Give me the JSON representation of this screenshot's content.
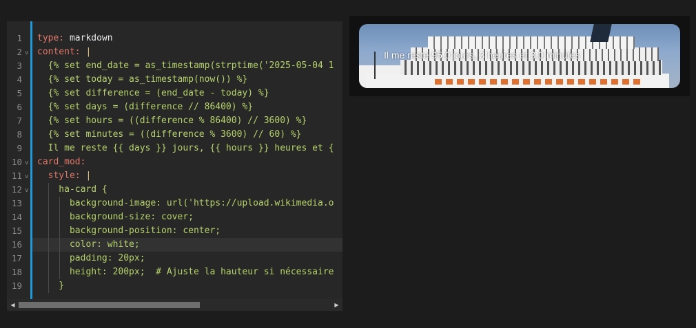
{
  "editor": {
    "lines": [
      {
        "n": "1",
        "parts": [
          {
            "c": "k",
            "t": "type:"
          },
          {
            "c": "t",
            "t": " markdown"
          }
        ]
      },
      {
        "n": "2",
        "fold": true,
        "parts": [
          {
            "c": "k",
            "t": "content:"
          },
          {
            "c": "t",
            "t": " "
          },
          {
            "c": "p",
            "t": "|"
          }
        ]
      },
      {
        "n": "3",
        "parts": [
          {
            "c": "j",
            "t": "  {% set end_date = as_timestamp(strptime('2025-05-04 1"
          }
        ]
      },
      {
        "n": "4",
        "parts": [
          {
            "c": "j",
            "t": "  {% set today = as_timestamp(now()) %}"
          }
        ]
      },
      {
        "n": "5",
        "parts": [
          {
            "c": "j",
            "t": "  {% set difference = (end_date - today) %}"
          }
        ]
      },
      {
        "n": "6",
        "parts": [
          {
            "c": "j",
            "t": "  {% set days = (difference // 86400) %}"
          }
        ]
      },
      {
        "n": "7",
        "parts": [
          {
            "c": "j",
            "t": "  {% set hours = ((difference % 86400) // 3600) %}"
          }
        ]
      },
      {
        "n": "8",
        "parts": [
          {
            "c": "j",
            "t": "  {% set minutes = ((difference % 3600) // 60) %}"
          }
        ]
      },
      {
        "n": "9",
        "parts": [
          {
            "c": "j",
            "t": "  Il me reste {{ days }} jours, {{ hours }} heures et {"
          }
        ]
      },
      {
        "n": "10",
        "fold": true,
        "parts": [
          {
            "c": "k",
            "t": "card_mod:"
          }
        ]
      },
      {
        "n": "11",
        "fold": true,
        "parts": [
          {
            "c": "t",
            "t": "  "
          },
          {
            "c": "k",
            "t": "style:"
          },
          {
            "c": "t",
            "t": " "
          },
          {
            "c": "p",
            "t": "|"
          }
        ]
      },
      {
        "n": "12",
        "fold": true,
        "parts": [
          {
            "c": "j",
            "t": "    ha-card {"
          }
        ]
      },
      {
        "n": "13",
        "parts": [
          {
            "c": "j",
            "t": "      background-image: url('https://upload.wikimedia.o"
          }
        ]
      },
      {
        "n": "14",
        "parts": [
          {
            "c": "j",
            "t": "      background-size: cover;"
          }
        ]
      },
      {
        "n": "15",
        "parts": [
          {
            "c": "j",
            "t": "      background-position: center;"
          }
        ]
      },
      {
        "n": "16",
        "active": true,
        "parts": [
          {
            "c": "j",
            "t": "      color: white;"
          }
        ]
      },
      {
        "n": "17",
        "parts": [
          {
            "c": "j",
            "t": "      padding: 20px;"
          }
        ]
      },
      {
        "n": "18",
        "parts": [
          {
            "c": "j",
            "t": "      height: 200px;  # Ajuste la hauteur si nécessaire"
          }
        ]
      },
      {
        "n": "19",
        "parts": [
          {
            "c": "j",
            "t": "    }"
          }
        ]
      }
    ],
    "scroll_left_arrow": "◀",
    "scroll_right_arrow": "▶",
    "fold_glyph": "v"
  },
  "preview": {
    "card_text": "Il me reste 95.0 jours, 3 heures et 3.0 minutes",
    "background_image": "cruise-ship-photo"
  },
  "colors": {
    "accent": "#1e9ad6",
    "yaml_key": "#e0786a",
    "jinja": "#b5d36a",
    "pipe": "#e5c07b"
  }
}
